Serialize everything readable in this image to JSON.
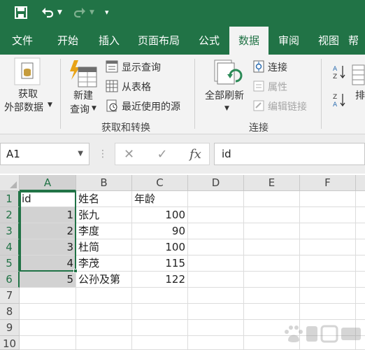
{
  "quick_access": {
    "save_icon": "save-icon",
    "undo_icon": "undo-icon",
    "redo_icon": "redo-icon",
    "customize_icon": "customize-qat-icon"
  },
  "tabs": [
    {
      "label": "文件"
    },
    {
      "label": "开始"
    },
    {
      "label": "插入"
    },
    {
      "label": "页面布局"
    },
    {
      "label": "公式"
    },
    {
      "label": "数据",
      "active": true
    },
    {
      "label": "审阅"
    },
    {
      "label": "视图"
    },
    {
      "label": "帮"
    }
  ],
  "ribbon": {
    "get_external_line1": "获取",
    "get_external_line2": "外部数据",
    "new_query_line1": "新建",
    "new_query_line2": "查询",
    "show_queries": "显示查询",
    "from_table": "从表格",
    "recent_sources": "最近使用的源",
    "group_get_transform": "获取和转换",
    "refresh_all": "全部刷新",
    "connections": "连接",
    "properties": "属性",
    "edit_links": "编辑链接",
    "group_connections": "连接",
    "sort_partial": "排"
  },
  "formula_bar": {
    "name_box": "A1",
    "cancel_symbol": "✕",
    "enter_symbol": "✓",
    "fx_symbol": "fx",
    "formula": "id"
  },
  "sheet": {
    "columns": [
      "A",
      "B",
      "C",
      "D",
      "E",
      "F"
    ],
    "rows": [
      "1",
      "2",
      "3",
      "4",
      "5",
      "6",
      "7",
      "8",
      "9",
      "10"
    ],
    "cells": {
      "A1": "id",
      "B1": "姓名",
      "C1": "年龄",
      "A2": "1",
      "B2": "张九",
      "C2": "100",
      "A3": "2",
      "B3": "李度",
      "C3": "90",
      "A4": "3",
      "B4": "杜简",
      "C4": "100",
      "A5": "4",
      "B5": "李茂",
      "C5": "115",
      "A6": "5",
      "B6": "公孙及第",
      "C6": "122"
    }
  },
  "colors": {
    "brand_green": "#217346",
    "selection_fill": "#d2d2d2"
  }
}
